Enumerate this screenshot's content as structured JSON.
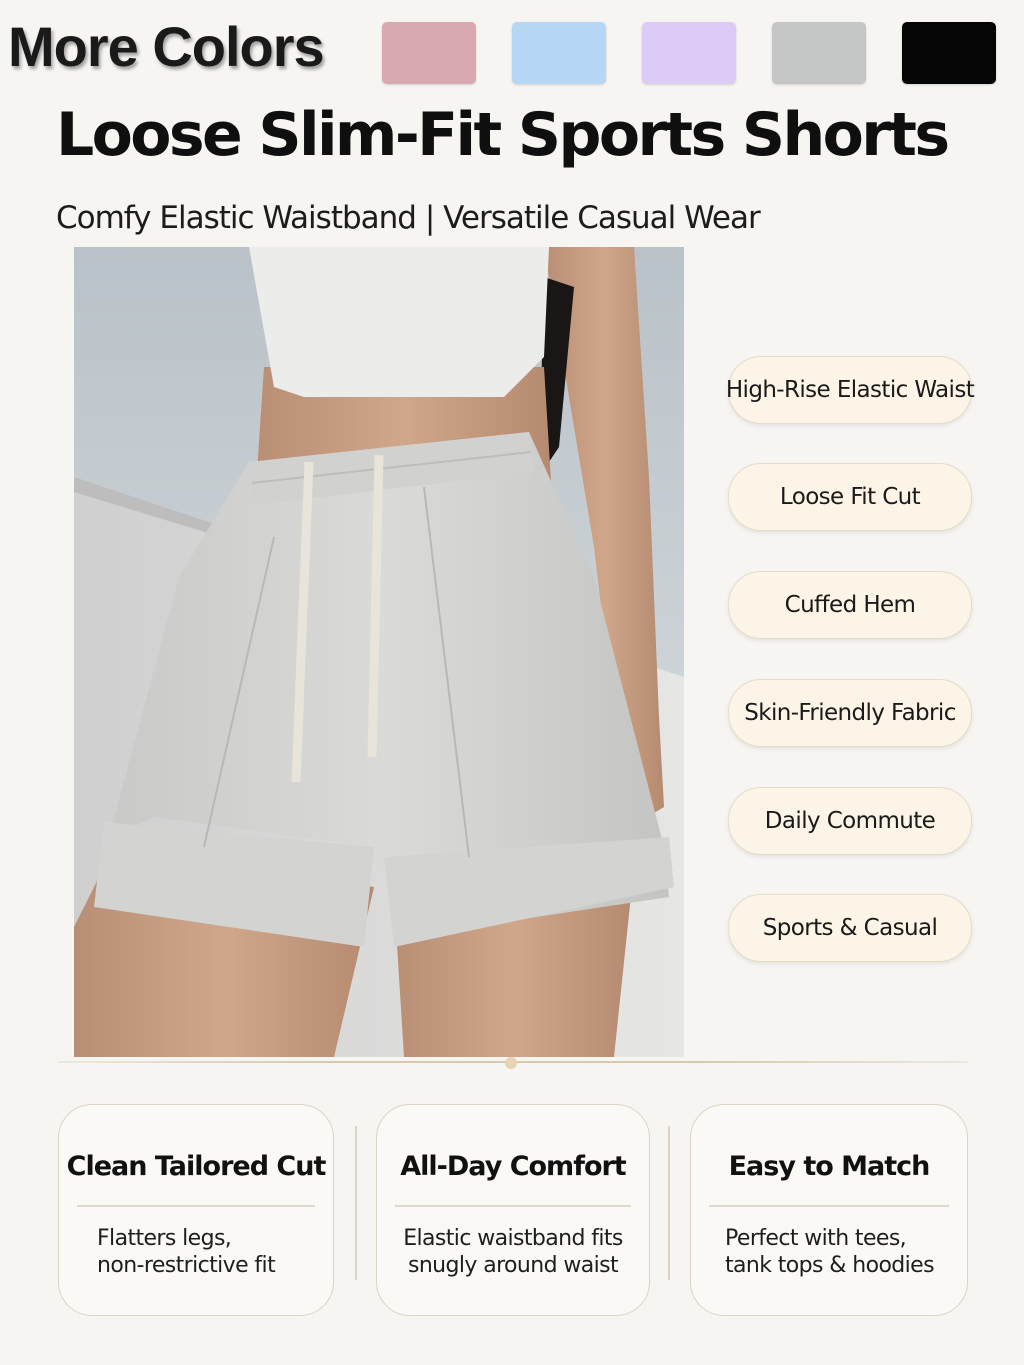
{
  "colors": {
    "label": "More Colors",
    "swatches": [
      {
        "name": "pink",
        "color": "#d8a9b0"
      },
      {
        "name": "light-blue",
        "color": "#b6d7f4"
      },
      {
        "name": "lavender",
        "color": "#dccbf6"
      },
      {
        "name": "grey",
        "color": "#c5c7c7"
      },
      {
        "name": "black",
        "color": "#050505"
      }
    ]
  },
  "product": {
    "title": "Loose Slim-Fit Sports Shorts",
    "subtitle": "Comfy Elastic Waistband | Versatile Casual Wear"
  },
  "features": [
    "High-Rise Elastic Waist",
    "Loose Fit Cut",
    "Cuffed Hem",
    "Skin-Friendly Fabric",
    "Daily Commute",
    "Sports & Casual"
  ],
  "cards": [
    {
      "title": "Clean Tailored Cut",
      "body": "Flatters legs,\nnon-restrictive fit"
    },
    {
      "title": "All-Day Comfort",
      "body": "Elastic waistband fits\nsnugly around waist"
    },
    {
      "title": "Easy to Match",
      "body": "Perfect with tees,\ntank tops & hoodies"
    }
  ],
  "accent_colors": {
    "pill_background": "#fcf4e6",
    "card_border": "#ddd3c2"
  }
}
